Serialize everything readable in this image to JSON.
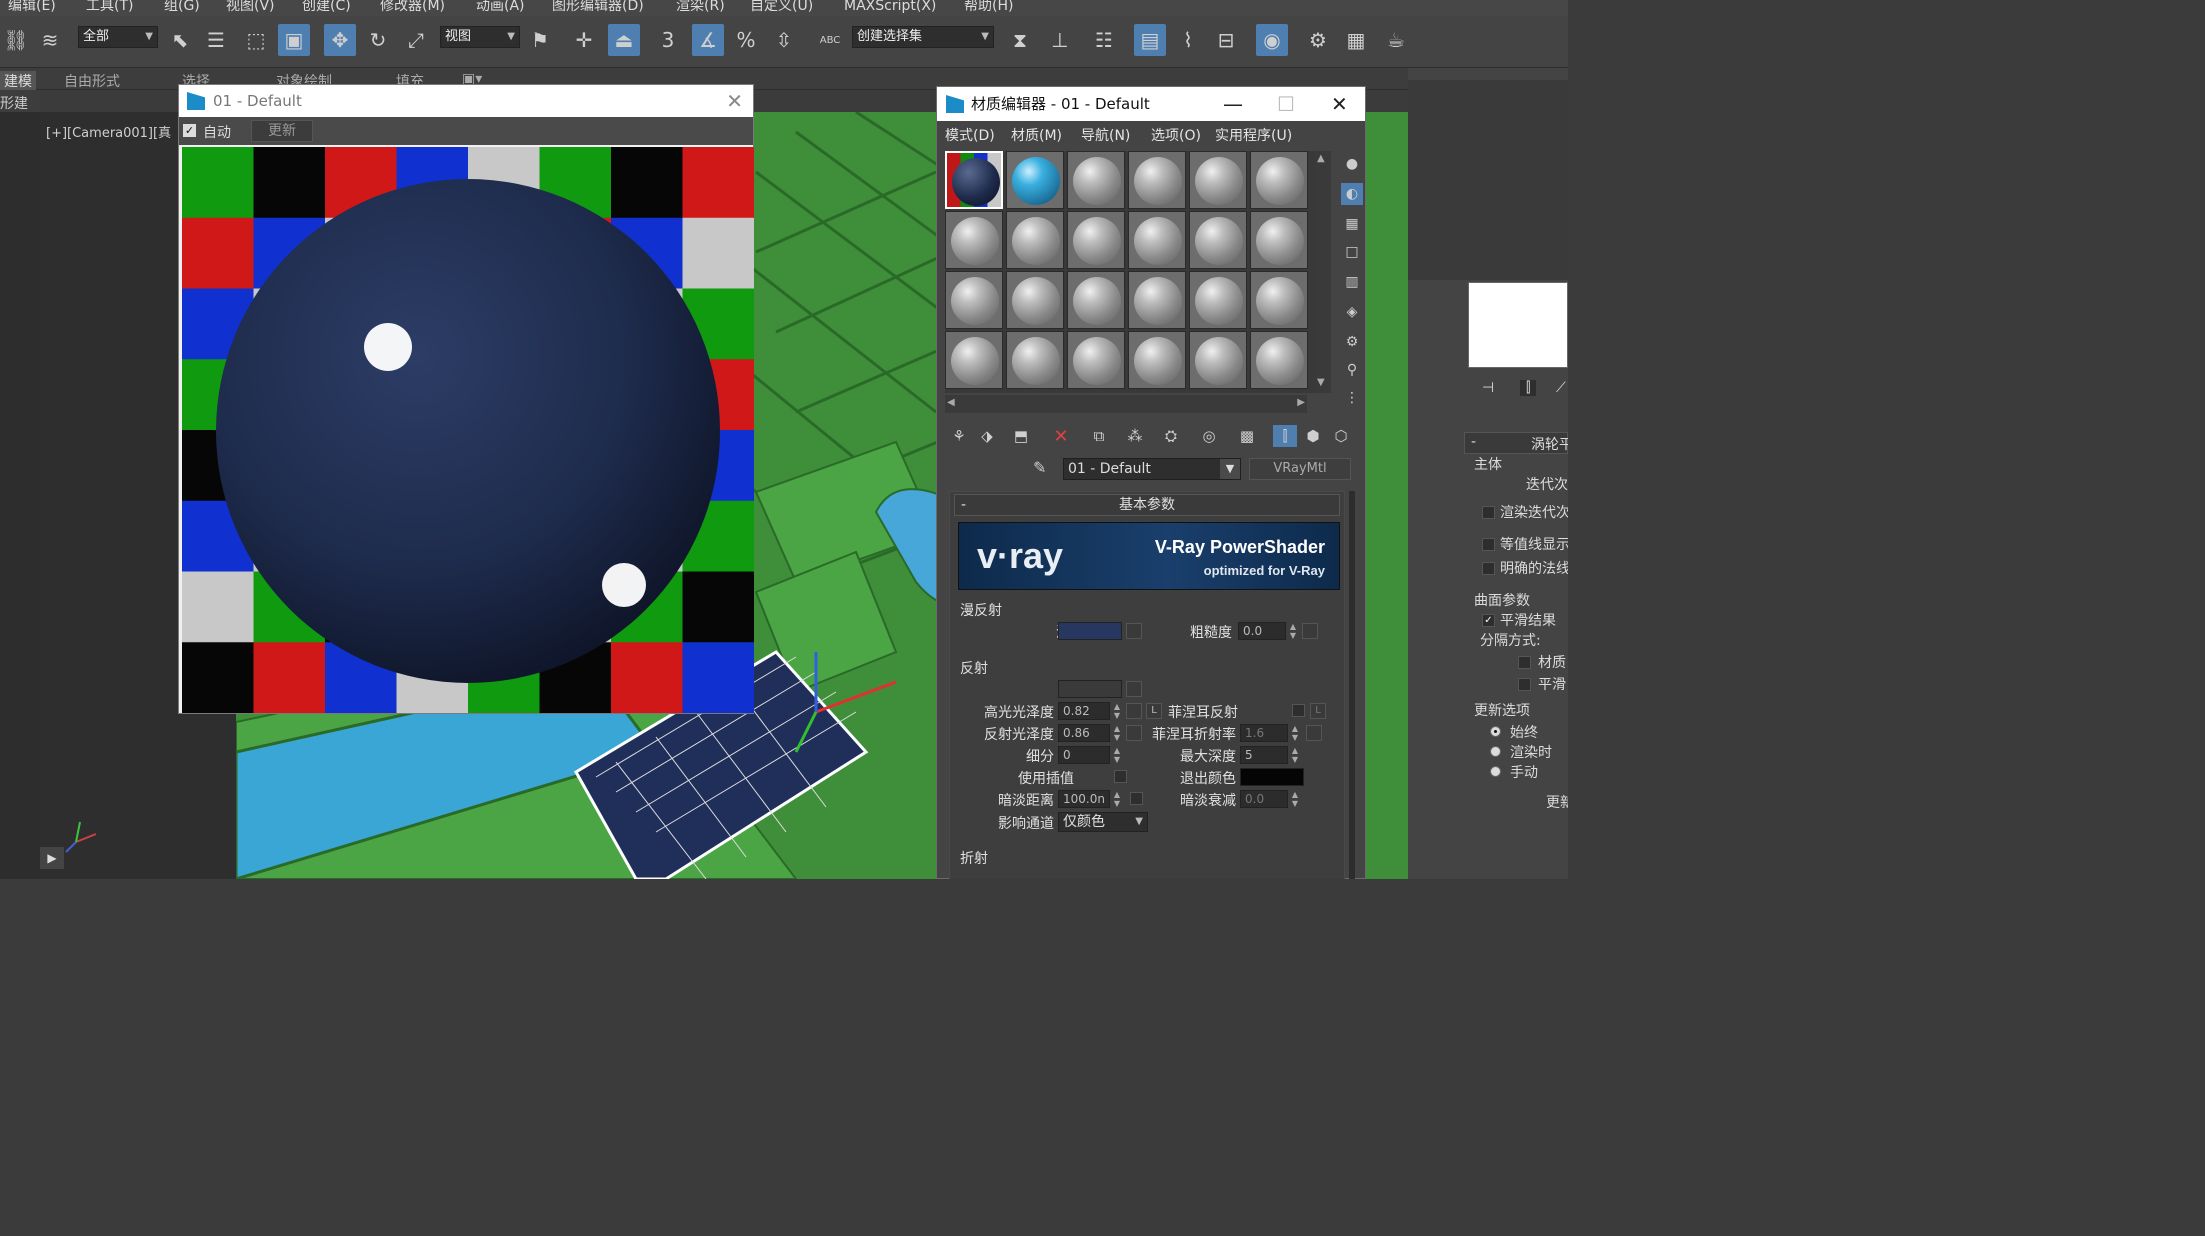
{
  "menu": [
    "编辑(E)",
    "工具(T)",
    "组(G)",
    "视图(V)",
    "创建(C)",
    "修改器(M)",
    "动画(A)",
    "图形编辑器(D)",
    "渲染(R)",
    "自定义(U)",
    "MAXScript(X)",
    "帮助(H)"
  ],
  "toolbar": {
    "filter_combo": "全部",
    "view_combo": "视图",
    "selection_set_combo": "创建选择集",
    "snap_3": "3",
    "abc_label": "ABC"
  },
  "ribbon": {
    "tab_modeling": "建模",
    "tab_freeform": "自由形式",
    "tab_selection": "选择",
    "tab_object_paint": "对象绘制",
    "tab_populate": "填充",
    "sub_label": "形建模"
  },
  "viewport": {
    "label": "[+][Camera001][真"
  },
  "render_window": {
    "title": "01 - Default",
    "auto_label": "自动",
    "update_button": "更新"
  },
  "material_editor": {
    "title": "材质编辑器 - 01 - Default",
    "menus": [
      "模式(D)",
      "材质(M)",
      "导航(N)",
      "选项(O)",
      "实用程序(U)"
    ],
    "material_name": "01 - Default",
    "material_type": "VRayMtl",
    "rollout_title": "基本参数",
    "rollout_minus": "-",
    "vray_logo": "v·ray",
    "vray_title": "V-Ray PowerShader",
    "vray_subtitle": "optimized for V-Ray",
    "diffuse_section": "漫反射",
    "diffuse_label": "漫反射",
    "roughness_label": "粗糙度",
    "roughness_value": "0.0",
    "reflection_section": "反射",
    "reflect_label": "反射",
    "hilight_gloss_label": "高光光泽度",
    "hilight_gloss_value": "0.82",
    "refl_gloss_label": "反射光泽度",
    "refl_gloss_value": "0.86",
    "subdivs_label": "细分",
    "subdivs_value": "0",
    "use_interp_label": "使用插值",
    "dim_distance_label": "暗淡距离",
    "dim_distance_value": "100.0n",
    "affect_channels_label": "影响通道",
    "affect_channels_value": "仅颜色",
    "fresnel_label": "菲涅耳反射",
    "fresnel_ior_label": "菲涅耳折射率",
    "fresnel_ior_value": "1.6",
    "max_depth_label": "最大深度",
    "max_depth_value": "5",
    "exit_color_label": "退出颜色",
    "dim_falloff_label": "暗淡衰减",
    "dim_falloff_value": "0.0",
    "refraction_section": "折射",
    "lock_label": "L",
    "diffuse_color": "#27375f",
    "reflect_color": "#3a3a3a",
    "exit_color": "#050505"
  },
  "command_panel": {
    "rollout": "涡轮平",
    "main_group": "主体",
    "iterations": "迭代次",
    "render_iters": "渲染迭代次",
    "isoline": "等值线显示",
    "explicit_normals": "明确的法线",
    "surface_params": "曲面参数",
    "smooth_result": "平滑结果",
    "separate_by": "分隔方式:",
    "materials": "材质",
    "smoothing": "平滑",
    "update_options": "更新选项",
    "always": "始终",
    "when_rendering": "渲染时",
    "manually": "手动",
    "update_button": "更新"
  },
  "colors": {
    "accent": "#4f7fb0",
    "scene_green": "#3f8f3a",
    "water_blue": "#3aa6d6",
    "vray_blue": "#1a3f6c"
  }
}
